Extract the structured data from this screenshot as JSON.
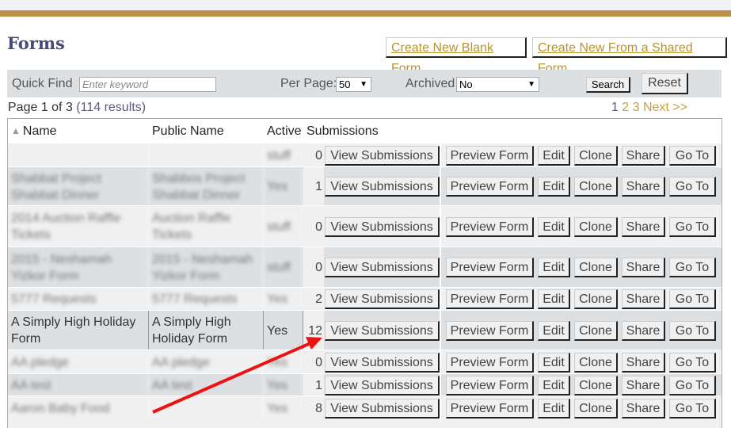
{
  "header": {
    "title": "Forms",
    "create_blank": "Create New Blank Form",
    "create_shared": "Create New From a Shared Form"
  },
  "filter": {
    "quick_find_label": "Quick Find",
    "keyword_placeholder": "Enter keyword",
    "per_page_label": "Per Page:",
    "per_page_value": "50",
    "archived_label": "Archived",
    "archived_value": "No",
    "search": "Search",
    "reset": "Reset"
  },
  "paging": {
    "info": "Page 1 of 3",
    "count": "(114 results)",
    "pages": [
      "1",
      "2",
      "3"
    ],
    "next": "Next >>"
  },
  "table": {
    "columns": [
      "Name",
      "Public Name",
      "Active",
      "Submissions"
    ],
    "actions": {
      "view": "View Submissions",
      "preview": "Preview Form",
      "edit": "Edit",
      "clone": "Clone",
      "share": "Share",
      "goto": "Go To"
    },
    "rows": [
      {
        "name": "",
        "public": "",
        "active": "stuff",
        "subs": "0",
        "blur": true
      },
      {
        "name": "Shabbat Project Shabbat Dinner",
        "public": "Shabbos Project Shabbat Dinner",
        "active": "Yes",
        "subs": "1",
        "blur": true
      },
      {
        "name": "2014 Auction Raffle Tickets",
        "public": "Auction Raffle Tickets",
        "active": "stuff",
        "subs": "0",
        "blur": true
      },
      {
        "name": "2015 - Neshamah Yizkor Form",
        "public": "2015 - Neshamah Yizkor Form",
        "active": "stuff",
        "subs": "0",
        "blur": true
      },
      {
        "name": "5777 Requests",
        "public": "5777 Requests",
        "active": "Yes",
        "subs": "2",
        "blur": true
      },
      {
        "name": "A Simply High Holiday Form",
        "public": "A Simply High Holiday Form",
        "active": "Yes",
        "subs": "12",
        "blur": false
      },
      {
        "name": "AA pledge",
        "public": "AA pledge",
        "active": "Yes",
        "subs": "0",
        "blur": true
      },
      {
        "name": "AA test",
        "public": "AA test",
        "active": "Yes",
        "subs": "1",
        "blur": true
      },
      {
        "name": "Aaron Baby Food",
        "public": "",
        "active": "Yes",
        "subs": "8",
        "blur": true
      }
    ]
  },
  "colors": {
    "gold": "#bd9248",
    "title": "#4a4a7a",
    "link": "#b8942e",
    "annotation_arrow": "#ee1111"
  }
}
